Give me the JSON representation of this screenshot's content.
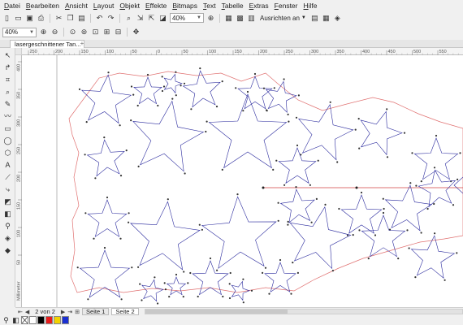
{
  "menu": [
    "Datei",
    "Bearbeiten",
    "Ansicht",
    "Layout",
    "Objekt",
    "Effekte",
    "Bitmaps",
    "Text",
    "Tabelle",
    "Extras",
    "Fenster",
    "Hilfe"
  ],
  "toolbar": {
    "zoom_value": "40%",
    "align_label": "Ausrichten an",
    "zoom2_value": "40%"
  },
  "doc_tab": {
    "title": "lasergeschnittener Tan...",
    "add_symbol": "+"
  },
  "ruler": {
    "h_labels": [
      "250",
      "200",
      "150",
      "100",
      "50",
      "0",
      "50",
      "100",
      "150",
      "200",
      "250",
      "300",
      "350",
      "400",
      "450",
      "500",
      "550"
    ],
    "v_labels": [
      "400",
      "350",
      "300",
      "250",
      "200",
      "150",
      "100",
      "50"
    ],
    "unit": "Millimeter"
  },
  "pager": {
    "status": "2 von 2",
    "tabs": [
      "Seite 1",
      "Seite 2"
    ],
    "active_tab": "Seite 2"
  },
  "palette": {
    "colors": [
      "#ffffff",
      "#000000",
      "#e81c1c",
      "#f2d200",
      "#1a2fd1"
    ]
  },
  "colors": {
    "cut_outline": "#e07070",
    "star_line": "#2b2b9e",
    "guide": "#d04040"
  }
}
